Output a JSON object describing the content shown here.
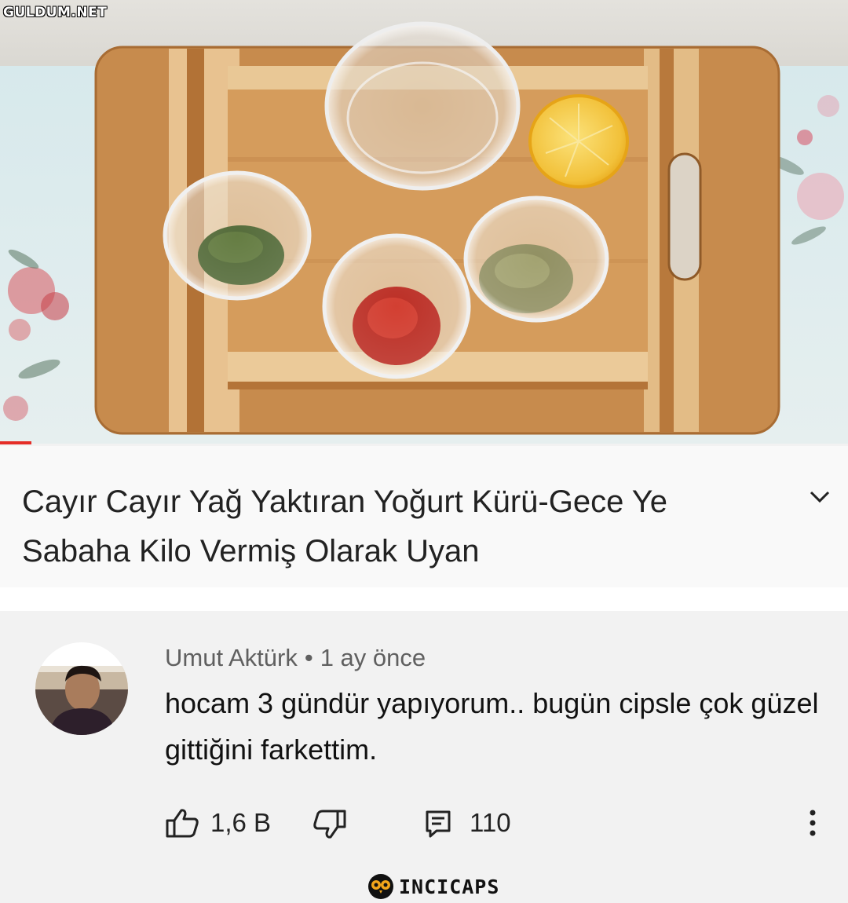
{
  "watermark": {
    "text": "GULDUM.NET"
  },
  "video": {
    "thumbnail_alt": "cutting board with bowls of spices and half lemon",
    "title": "Cayır Cayır Yağ Yaktıran Yoğurt Kürü-Gece Ye Sabaha Kilo Vermiş Olarak Uyan",
    "expand_icon": "chevron-down-icon"
  },
  "comment": {
    "author": "Umut Aktürk",
    "separator": "•",
    "time": "1 ay önce",
    "text": "hocam 3 gündür yapıyorum.. bugün cipsle çok güzel gittiğini farkettim.",
    "likes": "1,6 B",
    "replies": "110",
    "icons": {
      "like": "thumbs-up-icon",
      "dislike": "thumbs-down-icon",
      "reply": "reply-icon",
      "more": "more-vertical-icon"
    }
  },
  "branding": {
    "name": "INCICAPS",
    "logo_icon": "owl-logo-icon"
  },
  "colors": {
    "progress": "#e52d27",
    "title_bg": "#f9f9f9",
    "comment_bg": "#f2f2f2",
    "meta_text": "#606060"
  }
}
